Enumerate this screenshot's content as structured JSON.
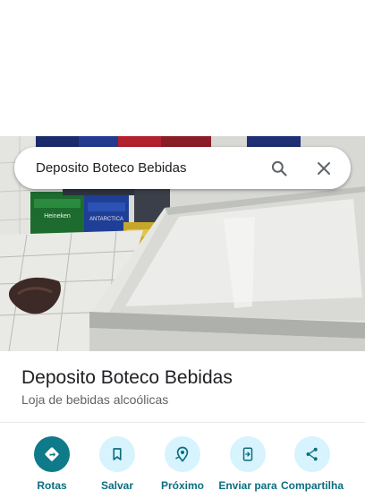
{
  "search": {
    "query": "Deposito Boteco Bebidas"
  },
  "place": {
    "name": "Deposito Boteco Bebidas",
    "category": "Loja de bebidas alcoólicas"
  },
  "actions": [
    {
      "label": "Rotas",
      "icon": "directions-icon"
    },
    {
      "label": "Salvar",
      "icon": "bookmark-icon"
    },
    {
      "label": "Próximo",
      "icon": "nearby-icon"
    },
    {
      "label": "Enviar para",
      "icon": "send-to-phone-icon"
    },
    {
      "label": "Compartilha",
      "icon": "share-icon"
    }
  ],
  "photo": {
    "crate_labels": [
      "Heineken",
      "ANTARCTICA"
    ]
  },
  "colors": {
    "accent": "#0e7a8a",
    "action_bg": "#d7f3fd",
    "action_text": "#0b6e7f"
  }
}
